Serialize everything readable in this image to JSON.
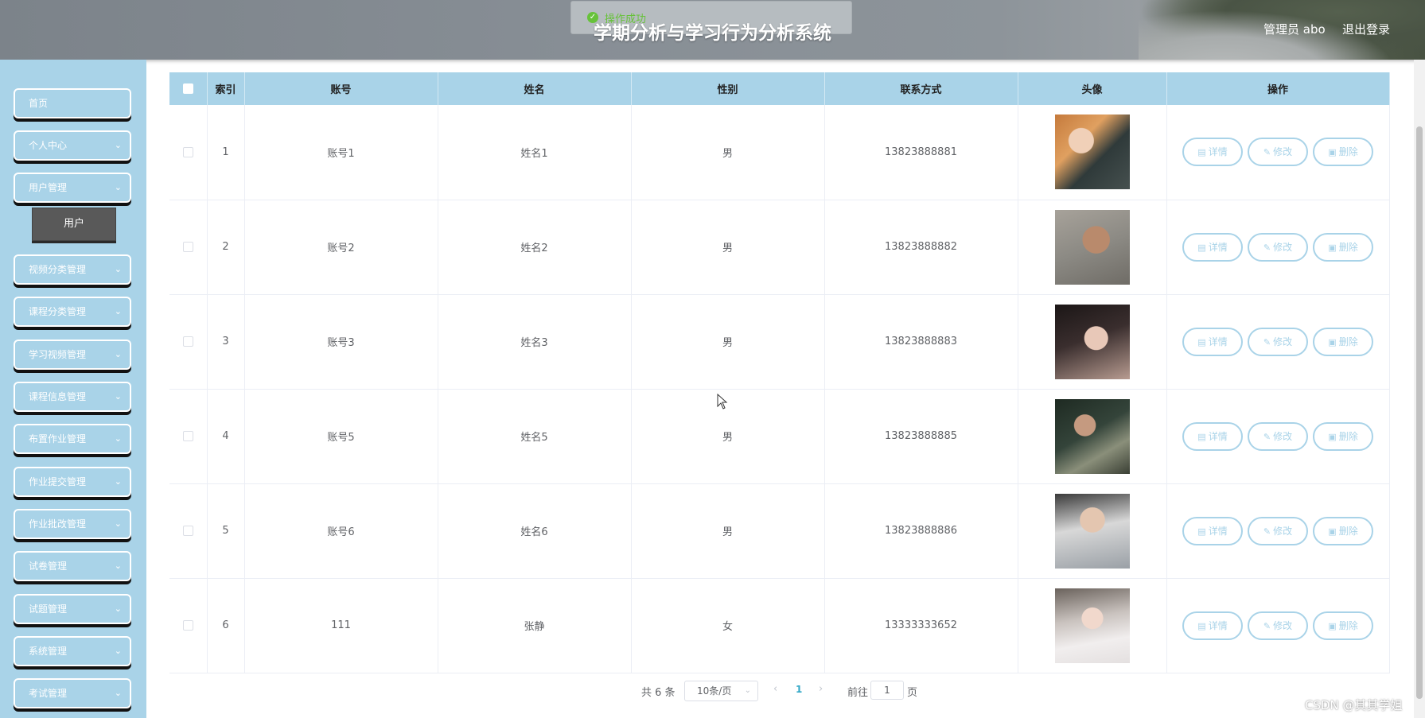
{
  "header": {
    "title": "学期分析与学习行为分析系统",
    "toast": "操作成功",
    "user_label": "管理员 abo",
    "logout": "退出登录"
  },
  "sidebar": {
    "items": [
      {
        "label": "首页",
        "has_chevron": false
      },
      {
        "label": "个人中心",
        "has_chevron": true
      },
      {
        "label": "用户管理",
        "has_chevron": true
      },
      {
        "label": "视频分类管理",
        "has_chevron": true
      },
      {
        "label": "课程分类管理",
        "has_chevron": true
      },
      {
        "label": "学习视频管理",
        "has_chevron": true
      },
      {
        "label": "课程信息管理",
        "has_chevron": true
      },
      {
        "label": "布置作业管理",
        "has_chevron": true
      },
      {
        "label": "作业提交管理",
        "has_chevron": true
      },
      {
        "label": "作业批改管理",
        "has_chevron": true
      },
      {
        "label": "试卷管理",
        "has_chevron": true
      },
      {
        "label": "试题管理",
        "has_chevron": true
      },
      {
        "label": "系统管理",
        "has_chevron": true
      },
      {
        "label": "考试管理",
        "has_chevron": true
      }
    ],
    "submenu": {
      "label": "用户"
    }
  },
  "table": {
    "columns": [
      "索引",
      "账号",
      "姓名",
      "性别",
      "联系方式",
      "头像",
      "操作"
    ],
    "rows": [
      {
        "index": "1",
        "account": "账号1",
        "name": "姓名1",
        "gender": "男",
        "phone": "13823888881"
      },
      {
        "index": "2",
        "account": "账号2",
        "name": "姓名2",
        "gender": "男",
        "phone": "13823888882"
      },
      {
        "index": "3",
        "account": "账号3",
        "name": "姓名3",
        "gender": "男",
        "phone": "13823888883"
      },
      {
        "index": "4",
        "account": "账号5",
        "name": "姓名5",
        "gender": "男",
        "phone": "13823888885"
      },
      {
        "index": "5",
        "account": "账号6",
        "name": "姓名6",
        "gender": "男",
        "phone": "13823888886"
      },
      {
        "index": "6",
        "account": "111",
        "name": "张静",
        "gender": "女",
        "phone": "13333333652"
      }
    ],
    "actions": {
      "detail": "详情",
      "edit": "修改",
      "delete": "删除"
    }
  },
  "pagination": {
    "total": "共 6 条",
    "page_size": "10条/页",
    "current_page": "1",
    "goto_label": "前往",
    "goto_value": "1",
    "page_suffix": "页"
  },
  "watermark": "CSDN @其其学姐",
  "colors": {
    "accent": "#a9d3e8",
    "sidebar_bg": "#a9d3e8",
    "submenu_bg": "#595959",
    "success": "#67c23a",
    "page_active": "#33a8c7"
  }
}
